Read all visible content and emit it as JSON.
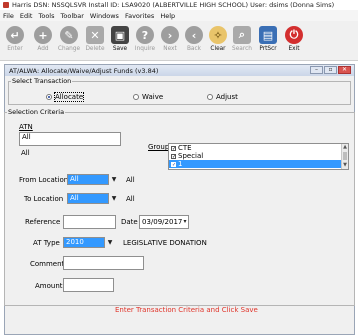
{
  "titlebar": {
    "text": "Harris  DSN: NSSQLSVR  Install ID: LSA9020 (ALBERTVILLE HIGH SCHOOL)  User: dsims (Donna Sims)"
  },
  "menu": [
    "File",
    "Edit",
    "Tools",
    "Toolbar",
    "Windows",
    "Favorites",
    "Help"
  ],
  "toolbar": [
    {
      "label": "Enter",
      "icon": "enter-icon",
      "glyph": "↵",
      "enabled": false
    },
    {
      "label": "Add",
      "icon": "add-icon",
      "glyph": "+",
      "enabled": false
    },
    {
      "label": "Change",
      "icon": "change-icon",
      "glyph": "✎",
      "enabled": false
    },
    {
      "label": "Delete",
      "icon": "delete-icon",
      "glyph": "✕",
      "enabled": false
    },
    {
      "label": "Save",
      "icon": "save-icon",
      "glyph": "▣",
      "enabled": true
    },
    {
      "label": "Inquire",
      "icon": "inquire-icon",
      "glyph": "?",
      "enabled": false
    },
    {
      "label": "Next",
      "icon": "next-icon",
      "glyph": "›",
      "enabled": false
    },
    {
      "label": "Back",
      "icon": "back-icon",
      "glyph": "‹",
      "enabled": false
    },
    {
      "label": "Clear",
      "icon": "clear-icon",
      "glyph": "✧",
      "enabled": true
    },
    {
      "label": "Search",
      "icon": "search-icon",
      "glyph": "⌕",
      "enabled": false
    },
    {
      "label": "PrtScr",
      "icon": "print-screen-icon",
      "glyph": "▤",
      "enabled": true
    },
    {
      "label": "Exit",
      "icon": "exit-icon",
      "glyph": "⏻",
      "enabled": true
    }
  ],
  "window": {
    "title": "AT/ALWA: Allocate/Waive/Adjust Funds (v3.84)"
  },
  "transaction": {
    "legend": "Select Transaction",
    "options": [
      "Allocate",
      "Waive",
      "Adjust"
    ],
    "selected": "Allocate"
  },
  "criteria": {
    "legend": "Selection Criteria",
    "atn_label": "ATN",
    "atn_value": "All",
    "atn_sub": "All",
    "group_label": "Group",
    "groups": [
      {
        "label": "CTE",
        "checked": true,
        "selected": false
      },
      {
        "label": "Special",
        "checked": true,
        "selected": false
      },
      {
        "label": "1",
        "checked": true,
        "selected": true
      }
    ]
  },
  "locations": {
    "from_label": "From Location",
    "from_value": "All",
    "from_desc": "All",
    "to_label": "To Location",
    "to_value": "All",
    "to_desc": "All"
  },
  "form": {
    "reference_label": "Reference",
    "reference_value": "",
    "date_label": "Date",
    "date_value": "03/09/2017",
    "attype_label": "AT Type",
    "attype_value": "2010",
    "attype_desc": "LEGISLATIVE DONATION",
    "comment_label": "Comment",
    "comment_value": "",
    "amount_label": "Amount",
    "amount_value": ""
  },
  "status": "Enter Transaction Criteria and Click Save"
}
